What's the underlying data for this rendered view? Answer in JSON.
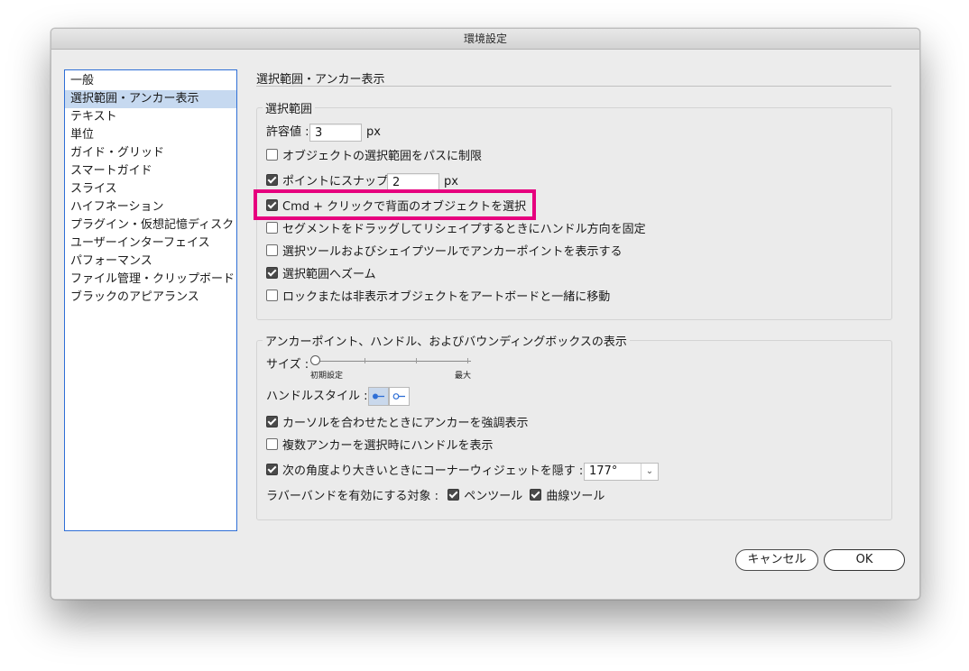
{
  "window": {
    "title": "環境設定"
  },
  "sidebar": {
    "items": [
      {
        "label": "一般",
        "selected": false
      },
      {
        "label": "選択範囲・アンカー表示",
        "selected": true
      },
      {
        "label": "テキスト",
        "selected": false
      },
      {
        "label": "単位",
        "selected": false
      },
      {
        "label": "ガイド・グリッド",
        "selected": false
      },
      {
        "label": "スマートガイド",
        "selected": false
      },
      {
        "label": "スライス",
        "selected": false
      },
      {
        "label": "ハイフネーション",
        "selected": false
      },
      {
        "label": "プラグイン・仮想記憶ディスク",
        "selected": false
      },
      {
        "label": "ユーザーインターフェイス",
        "selected": false
      },
      {
        "label": "パフォーマンス",
        "selected": false
      },
      {
        "label": "ファイル管理・クリップボード",
        "selected": false
      },
      {
        "label": "ブラックのアピアランス",
        "selected": false
      }
    ]
  },
  "main": {
    "section_title": "選択範囲・アンカー表示",
    "selection_group": {
      "label": "選択範囲",
      "tolerance_label": "許容値 :",
      "tolerance_value": "3",
      "tolerance_unit": "px",
      "options": [
        {
          "label": "オブジェクトの選択範囲をパスに制限",
          "checked": false
        },
        {
          "label": "ポイントにスナップ",
          "checked": true,
          "value": "2",
          "unit": "px"
        },
        {
          "label": "Cmd + クリックで背面のオブジェクトを選択",
          "checked": true,
          "highlighted": true
        },
        {
          "label": "セグメントをドラッグしてリシェイプするときにハンドル方向を固定",
          "checked": false
        },
        {
          "label": "選択ツールおよびシェイプツールでアンカーポイントを表示する",
          "checked": false
        },
        {
          "label": "選択範囲へズーム",
          "checked": true
        },
        {
          "label": "ロックまたは非表示オブジェクトをアートボードと一緒に移動",
          "checked": false
        }
      ]
    },
    "anchor_group": {
      "label": "アンカーポイント、ハンドル、およびバウンディングボックスの表示",
      "size_label": "サイズ :",
      "size_min_label": "初期設定",
      "size_max_label": "最大",
      "handle_style_label": "ハンドルスタイル :",
      "options": [
        {
          "label": "カーソルを合わせたときにアンカーを強調表示",
          "checked": true
        },
        {
          "label": "複数アンカーを選択時にハンドルを表示",
          "checked": false
        },
        {
          "label": "次の角度より大きいときにコーナーウィジェットを隠す :",
          "checked": true
        }
      ],
      "angle_value": "177°",
      "rubber_band_label": "ラバーバンドを有効にする対象 :",
      "pen_tool_label": "ペンツール",
      "pen_tool_checked": true,
      "curvature_tool_label": "曲線ツール",
      "curvature_tool_checked": true
    }
  },
  "buttons": {
    "cancel": "キャンセル",
    "ok": "OK"
  },
  "colors": {
    "highlight": "#e6007e",
    "sidebar_selection": "#c6d9f0",
    "accent": "#2f6fd6"
  }
}
